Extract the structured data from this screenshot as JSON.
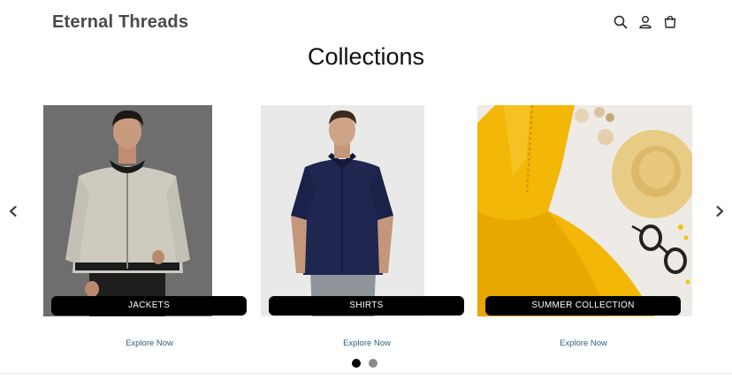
{
  "header": {
    "brand": "Eternal Threads",
    "icons": [
      "search-icon",
      "account-icon",
      "cart-icon"
    ]
  },
  "page": {
    "title": "Collections"
  },
  "carousel": {
    "prev_icon": "chevron-left-icon",
    "next_icon": "chevron-right-icon",
    "cards": [
      {
        "label": "JACKETS",
        "link": "Explore Now",
        "image": "man in beige bomber jacket on grey background"
      },
      {
        "label": "SHIRTS",
        "link": "Explore Now",
        "image": "man in navy shirt and grey jeans on light background"
      },
      {
        "label": "SUMMER COLLECTION",
        "link": "Explore Now",
        "image": "yellow summer dress, straw hat and sunglasses flat lay"
      }
    ],
    "pagination": {
      "pages": 2,
      "active_index": 0
    }
  },
  "colors": {
    "link": "#2b5f86",
    "label_bg": "#000000",
    "dot_active": "#000000",
    "dot_inactive": "#8a8a8a"
  }
}
